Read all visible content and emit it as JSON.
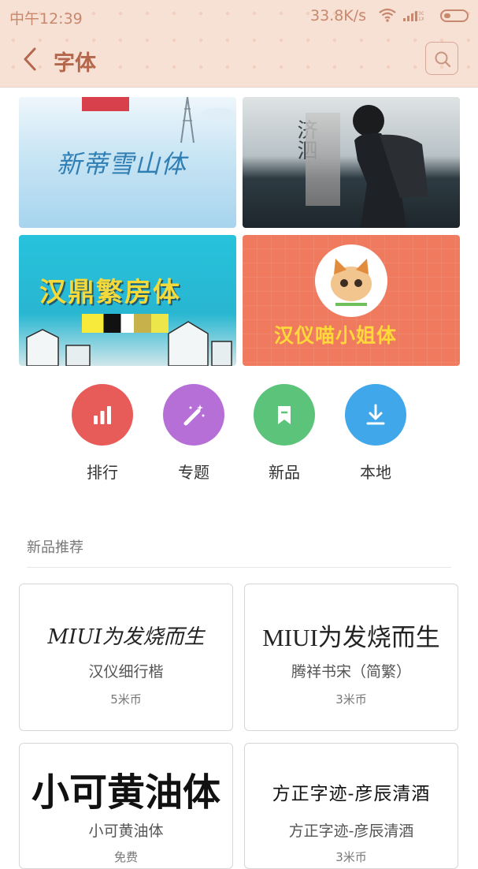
{
  "status_bar": {
    "time": "中午12:39",
    "speed": "33.8K/s",
    "network_label": "3G 1X"
  },
  "header": {
    "title": "字体"
  },
  "banners": [
    {
      "text": "新蒂雪山体"
    },
    {
      "text": "济泗"
    },
    {
      "text": "汉鼎繁房体"
    },
    {
      "text": "汉仪喵小姐体"
    }
  ],
  "categories": [
    {
      "label": "排行",
      "color": "#e75c58",
      "icon": "bar-chart-icon"
    },
    {
      "label": "专题",
      "color": "#b76fd8",
      "icon": "magic-wand-icon"
    },
    {
      "label": "新品",
      "color": "#5cc37a",
      "icon": "bookmark-icon"
    },
    {
      "label": "本地",
      "color": "#3fa7ea",
      "icon": "download-icon"
    }
  ],
  "section": {
    "title": "新品推荐"
  },
  "fonts": [
    {
      "preview": "MIUI为发烧而生",
      "name": "汉仪细行楷",
      "price": "5米币"
    },
    {
      "preview": "MIUI为发烧而生",
      "name": "腾祥书宋（简繁）",
      "price": "3米币"
    },
    {
      "preview": "小可黄油体",
      "name": "小可黄油体",
      "price": "免费"
    },
    {
      "preview": "方正字迹-彦辰清酒",
      "name": "方正字迹-彦辰清酒",
      "price": "3米币"
    }
  ],
  "colors": {
    "accent": "#b4674c",
    "topbar": "#f7e1d5"
  }
}
